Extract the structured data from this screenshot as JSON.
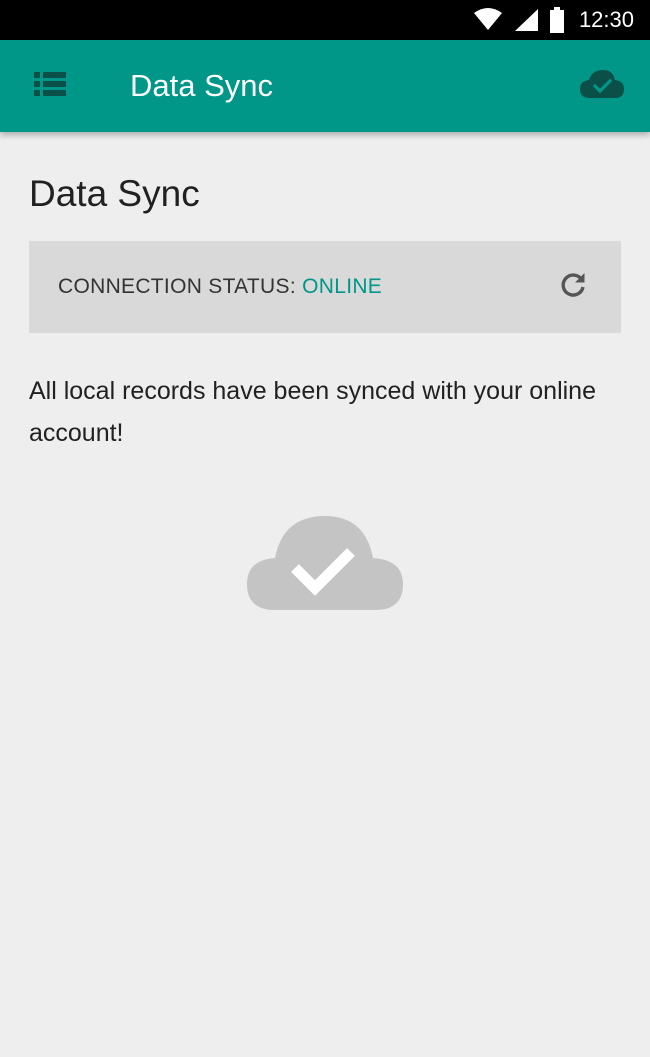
{
  "status_bar": {
    "time": "12:30",
    "icons": [
      "wifi-icon",
      "signal-icon",
      "battery-icon"
    ]
  },
  "app_bar": {
    "title": "Data Sync",
    "menu_icon": "list-menu-icon",
    "action_icon": "cloud-done-icon",
    "color": "#009688"
  },
  "main": {
    "heading": "Data Sync",
    "connection": {
      "label": "CONNECTION STATUS:",
      "value": "ONLINE",
      "value_color": "#009688",
      "refresh_icon": "refresh-icon"
    },
    "message": "All local records have been synced with your online account!",
    "illustration_icon": "cloud-done-icon"
  }
}
